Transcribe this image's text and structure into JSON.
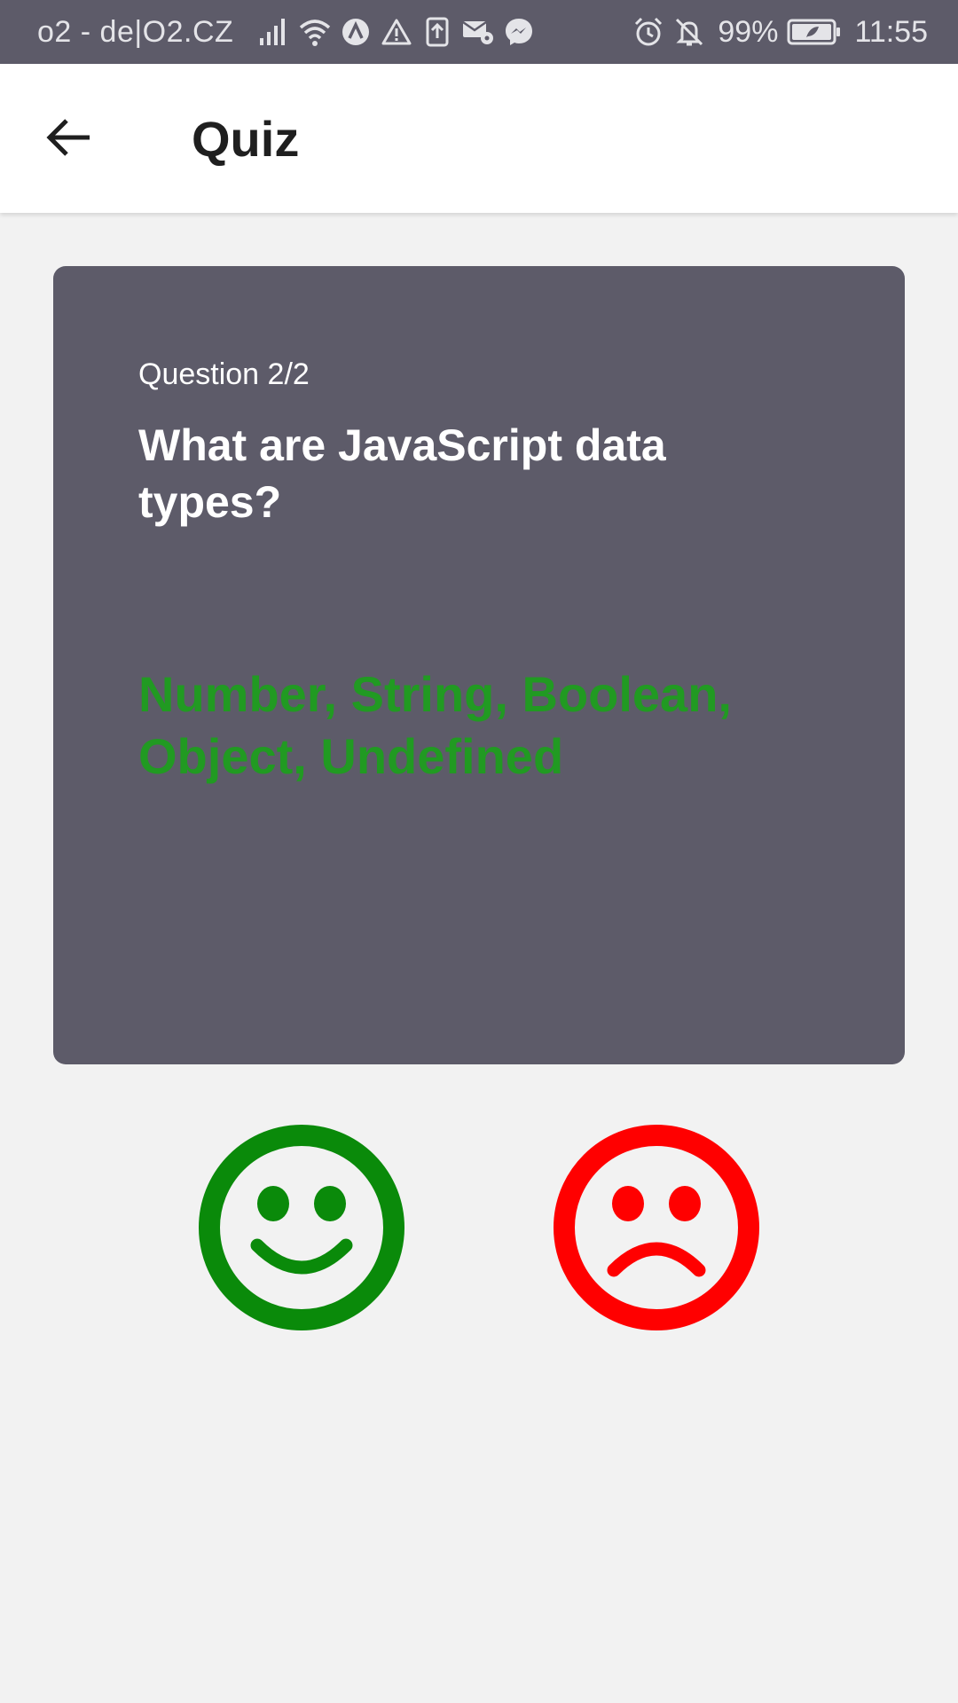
{
  "status_bar": {
    "carrier": "o2 - de|O2.CZ",
    "battery_percent": "99%",
    "time": "11:55",
    "icons": [
      "signal-icon",
      "wifi-icon",
      "app-icon",
      "warning-icon",
      "upload-icon",
      "mail-settings-icon",
      "messenger-icon",
      "alarm-icon",
      "notifications-off-icon",
      "battery-icon"
    ]
  },
  "app_bar": {
    "title": "Quiz",
    "back_icon": "arrow-left-icon"
  },
  "card": {
    "counter": "Question 2/2",
    "question": "What are JavaScript data types?",
    "answer": "Number, String, Boolean, Object, Undefined",
    "background": "#5d5b69",
    "answer_color": "#219a22"
  },
  "feedback": {
    "correct_icon": "smile-icon",
    "correct_color": "#0a8a0a",
    "incorrect_icon": "frown-icon",
    "incorrect_color": "#ff0000"
  }
}
